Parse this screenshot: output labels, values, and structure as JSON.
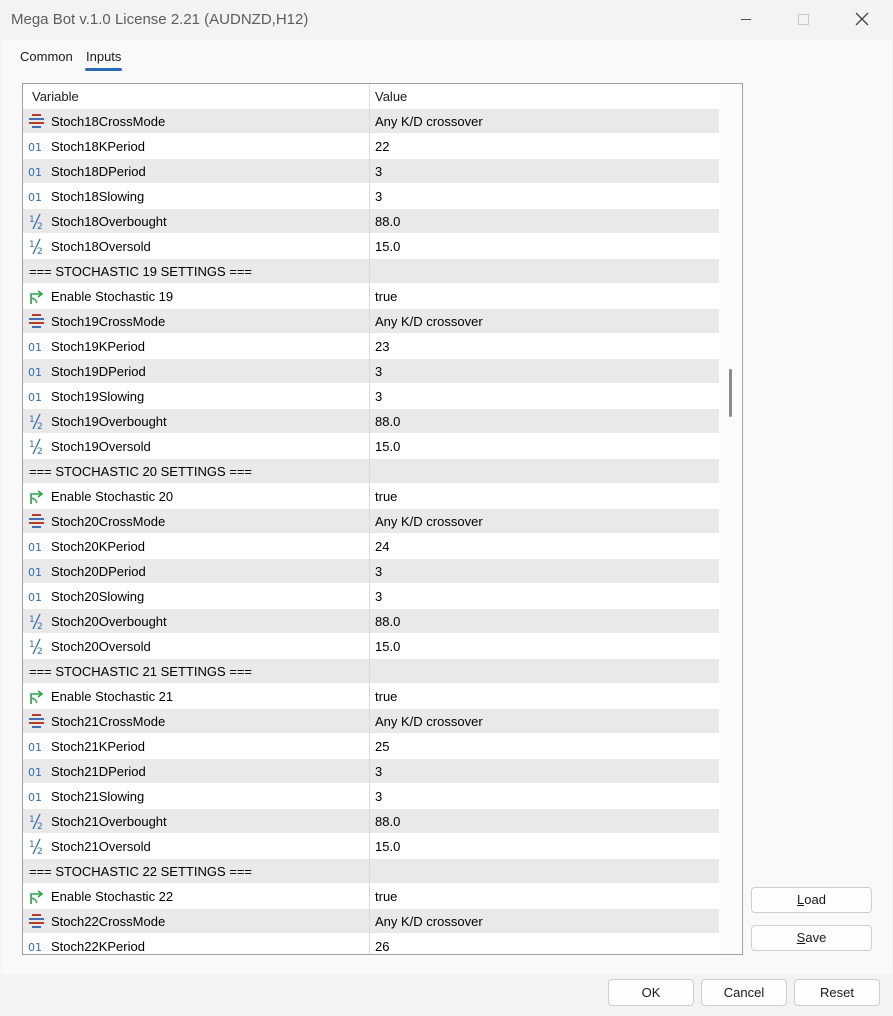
{
  "window": {
    "title": "Mega Bot v.1.0 License 2.21 (AUDNZD,H12)",
    "minimize_icon": "minimize-icon",
    "maximize_icon": "maximize-icon",
    "close_icon": "close-icon"
  },
  "tabs": [
    {
      "label": "Common",
      "active": false
    },
    {
      "label": "Inputs",
      "active": true
    }
  ],
  "grid": {
    "headers": {
      "variable": "Variable",
      "value": "Value"
    },
    "rows": [
      {
        "type": "enum",
        "name": "Stoch18CrossMode",
        "value": "Any K/D crossover"
      },
      {
        "type": "int",
        "name": "Stoch18KPeriod",
        "value": "22"
      },
      {
        "type": "int",
        "name": "Stoch18DPeriod",
        "value": "3"
      },
      {
        "type": "int",
        "name": "Stoch18Slowing",
        "value": "3"
      },
      {
        "type": "double",
        "name": "Stoch18Overbought",
        "value": "88.0"
      },
      {
        "type": "double",
        "name": "Stoch18Oversold",
        "value": "15.0"
      },
      {
        "type": "section",
        "name": "=== STOCHASTIC 19 SETTINGS ===",
        "value": ""
      },
      {
        "type": "bool",
        "name": "Enable Stochastic 19",
        "value": "true"
      },
      {
        "type": "enum",
        "name": "Stoch19CrossMode",
        "value": "Any K/D crossover"
      },
      {
        "type": "int",
        "name": "Stoch19KPeriod",
        "value": "23"
      },
      {
        "type": "int",
        "name": "Stoch19DPeriod",
        "value": "3"
      },
      {
        "type": "int",
        "name": "Stoch19Slowing",
        "value": "3"
      },
      {
        "type": "double",
        "name": "Stoch19Overbought",
        "value": "88.0"
      },
      {
        "type": "double",
        "name": "Stoch19Oversold",
        "value": "15.0"
      },
      {
        "type": "section",
        "name": "=== STOCHASTIC 20 SETTINGS ===",
        "value": ""
      },
      {
        "type": "bool",
        "name": "Enable Stochastic 20",
        "value": "true"
      },
      {
        "type": "enum",
        "name": "Stoch20CrossMode",
        "value": "Any K/D crossover"
      },
      {
        "type": "int",
        "name": "Stoch20KPeriod",
        "value": "24"
      },
      {
        "type": "int",
        "name": "Stoch20DPeriod",
        "value": "3"
      },
      {
        "type": "int",
        "name": "Stoch20Slowing",
        "value": "3"
      },
      {
        "type": "double",
        "name": "Stoch20Overbought",
        "value": "88.0"
      },
      {
        "type": "double",
        "name": "Stoch20Oversold",
        "value": "15.0"
      },
      {
        "type": "section",
        "name": "=== STOCHASTIC 21 SETTINGS ===",
        "value": ""
      },
      {
        "type": "bool",
        "name": "Enable Stochastic 21",
        "value": "true"
      },
      {
        "type": "enum",
        "name": "Stoch21CrossMode",
        "value": "Any K/D crossover"
      },
      {
        "type": "int",
        "name": "Stoch21KPeriod",
        "value": "25"
      },
      {
        "type": "int",
        "name": "Stoch21DPeriod",
        "value": "3"
      },
      {
        "type": "int",
        "name": "Stoch21Slowing",
        "value": "3"
      },
      {
        "type": "double",
        "name": "Stoch21Overbought",
        "value": "88.0"
      },
      {
        "type": "double",
        "name": "Stoch21Oversold",
        "value": "15.0"
      },
      {
        "type": "section",
        "name": "=== STOCHASTIC 22 SETTINGS ===",
        "value": ""
      },
      {
        "type": "bool",
        "name": "Enable Stochastic 22",
        "value": "true"
      },
      {
        "type": "enum",
        "name": "Stoch22CrossMode",
        "value": "Any K/D crossover"
      },
      {
        "type": "int",
        "name": "Stoch22KPeriod",
        "value": "26"
      }
    ],
    "type_icons": {
      "enum": "enum-list-icon",
      "int": "integer-01-icon",
      "double": "fraction-half-icon",
      "bool": "boolean-arrow-icon"
    }
  },
  "buttons": {
    "load": {
      "underlined": "L",
      "rest": "oad"
    },
    "save": {
      "underlined": "S",
      "rest": "ave"
    },
    "ok": "OK",
    "cancel": "Cancel",
    "reset": "Reset"
  },
  "colors": {
    "accent": "#2a69b4",
    "int_icon": "#2f6db5",
    "bool_icon": "#2aa14a",
    "enum_icon_red": "#c0392b",
    "enum_icon_blue": "#3f6fb0"
  }
}
